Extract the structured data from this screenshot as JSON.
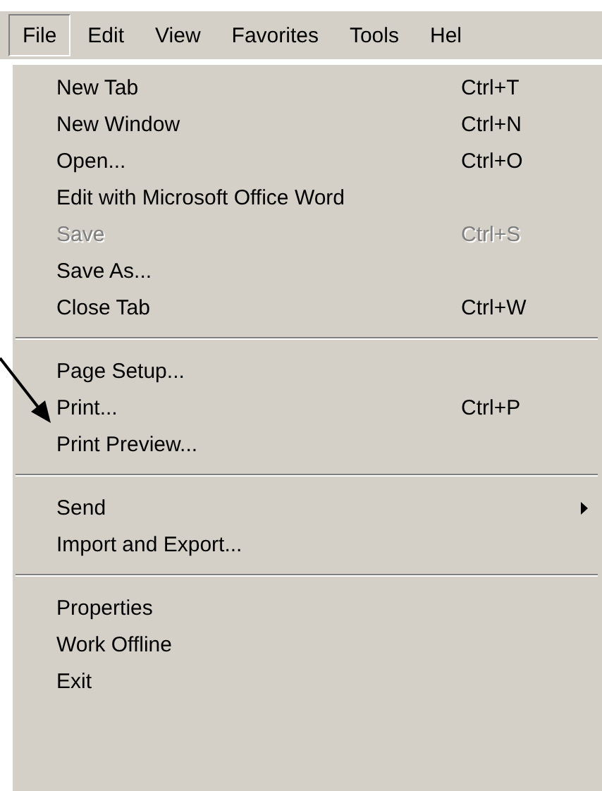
{
  "menubar": [
    {
      "label": "File",
      "selected": true
    },
    {
      "label": "Edit",
      "selected": false
    },
    {
      "label": "View",
      "selected": false
    },
    {
      "label": "Favorites",
      "selected": false
    },
    {
      "label": "Tools",
      "selected": false
    },
    {
      "label": "Hel",
      "selected": false
    }
  ],
  "menu": [
    {
      "kind": "item",
      "label": "New Tab",
      "shortcut": "Ctrl+T",
      "disabled": false
    },
    {
      "kind": "item",
      "label": "New Window",
      "shortcut": "Ctrl+N",
      "disabled": false
    },
    {
      "kind": "item",
      "label": "Open...",
      "shortcut": "Ctrl+O",
      "disabled": false
    },
    {
      "kind": "item",
      "label": "Edit with Microsoft Office Word",
      "disabled": false
    },
    {
      "kind": "item",
      "label": "Save",
      "shortcut": "Ctrl+S",
      "disabled": true
    },
    {
      "kind": "item",
      "label": "Save As...",
      "disabled": false
    },
    {
      "kind": "item",
      "label": "Close Tab",
      "shortcut": "Ctrl+W",
      "disabled": false
    },
    {
      "kind": "separator"
    },
    {
      "kind": "item",
      "label": "Page Setup...",
      "disabled": false
    },
    {
      "kind": "item",
      "label": "Print...",
      "shortcut": "Ctrl+P",
      "disabled": false
    },
    {
      "kind": "item",
      "label": "Print Preview...",
      "disabled": false
    },
    {
      "kind": "separator"
    },
    {
      "kind": "submenu",
      "label": "Send",
      "disabled": false
    },
    {
      "kind": "item",
      "label": "Import and Export...",
      "disabled": false
    },
    {
      "kind": "separator"
    },
    {
      "kind": "item",
      "label": "Properties",
      "disabled": false
    },
    {
      "kind": "item",
      "label": "Work Offline",
      "disabled": false
    },
    {
      "kind": "item",
      "label": "Exit",
      "disabled": false
    }
  ]
}
